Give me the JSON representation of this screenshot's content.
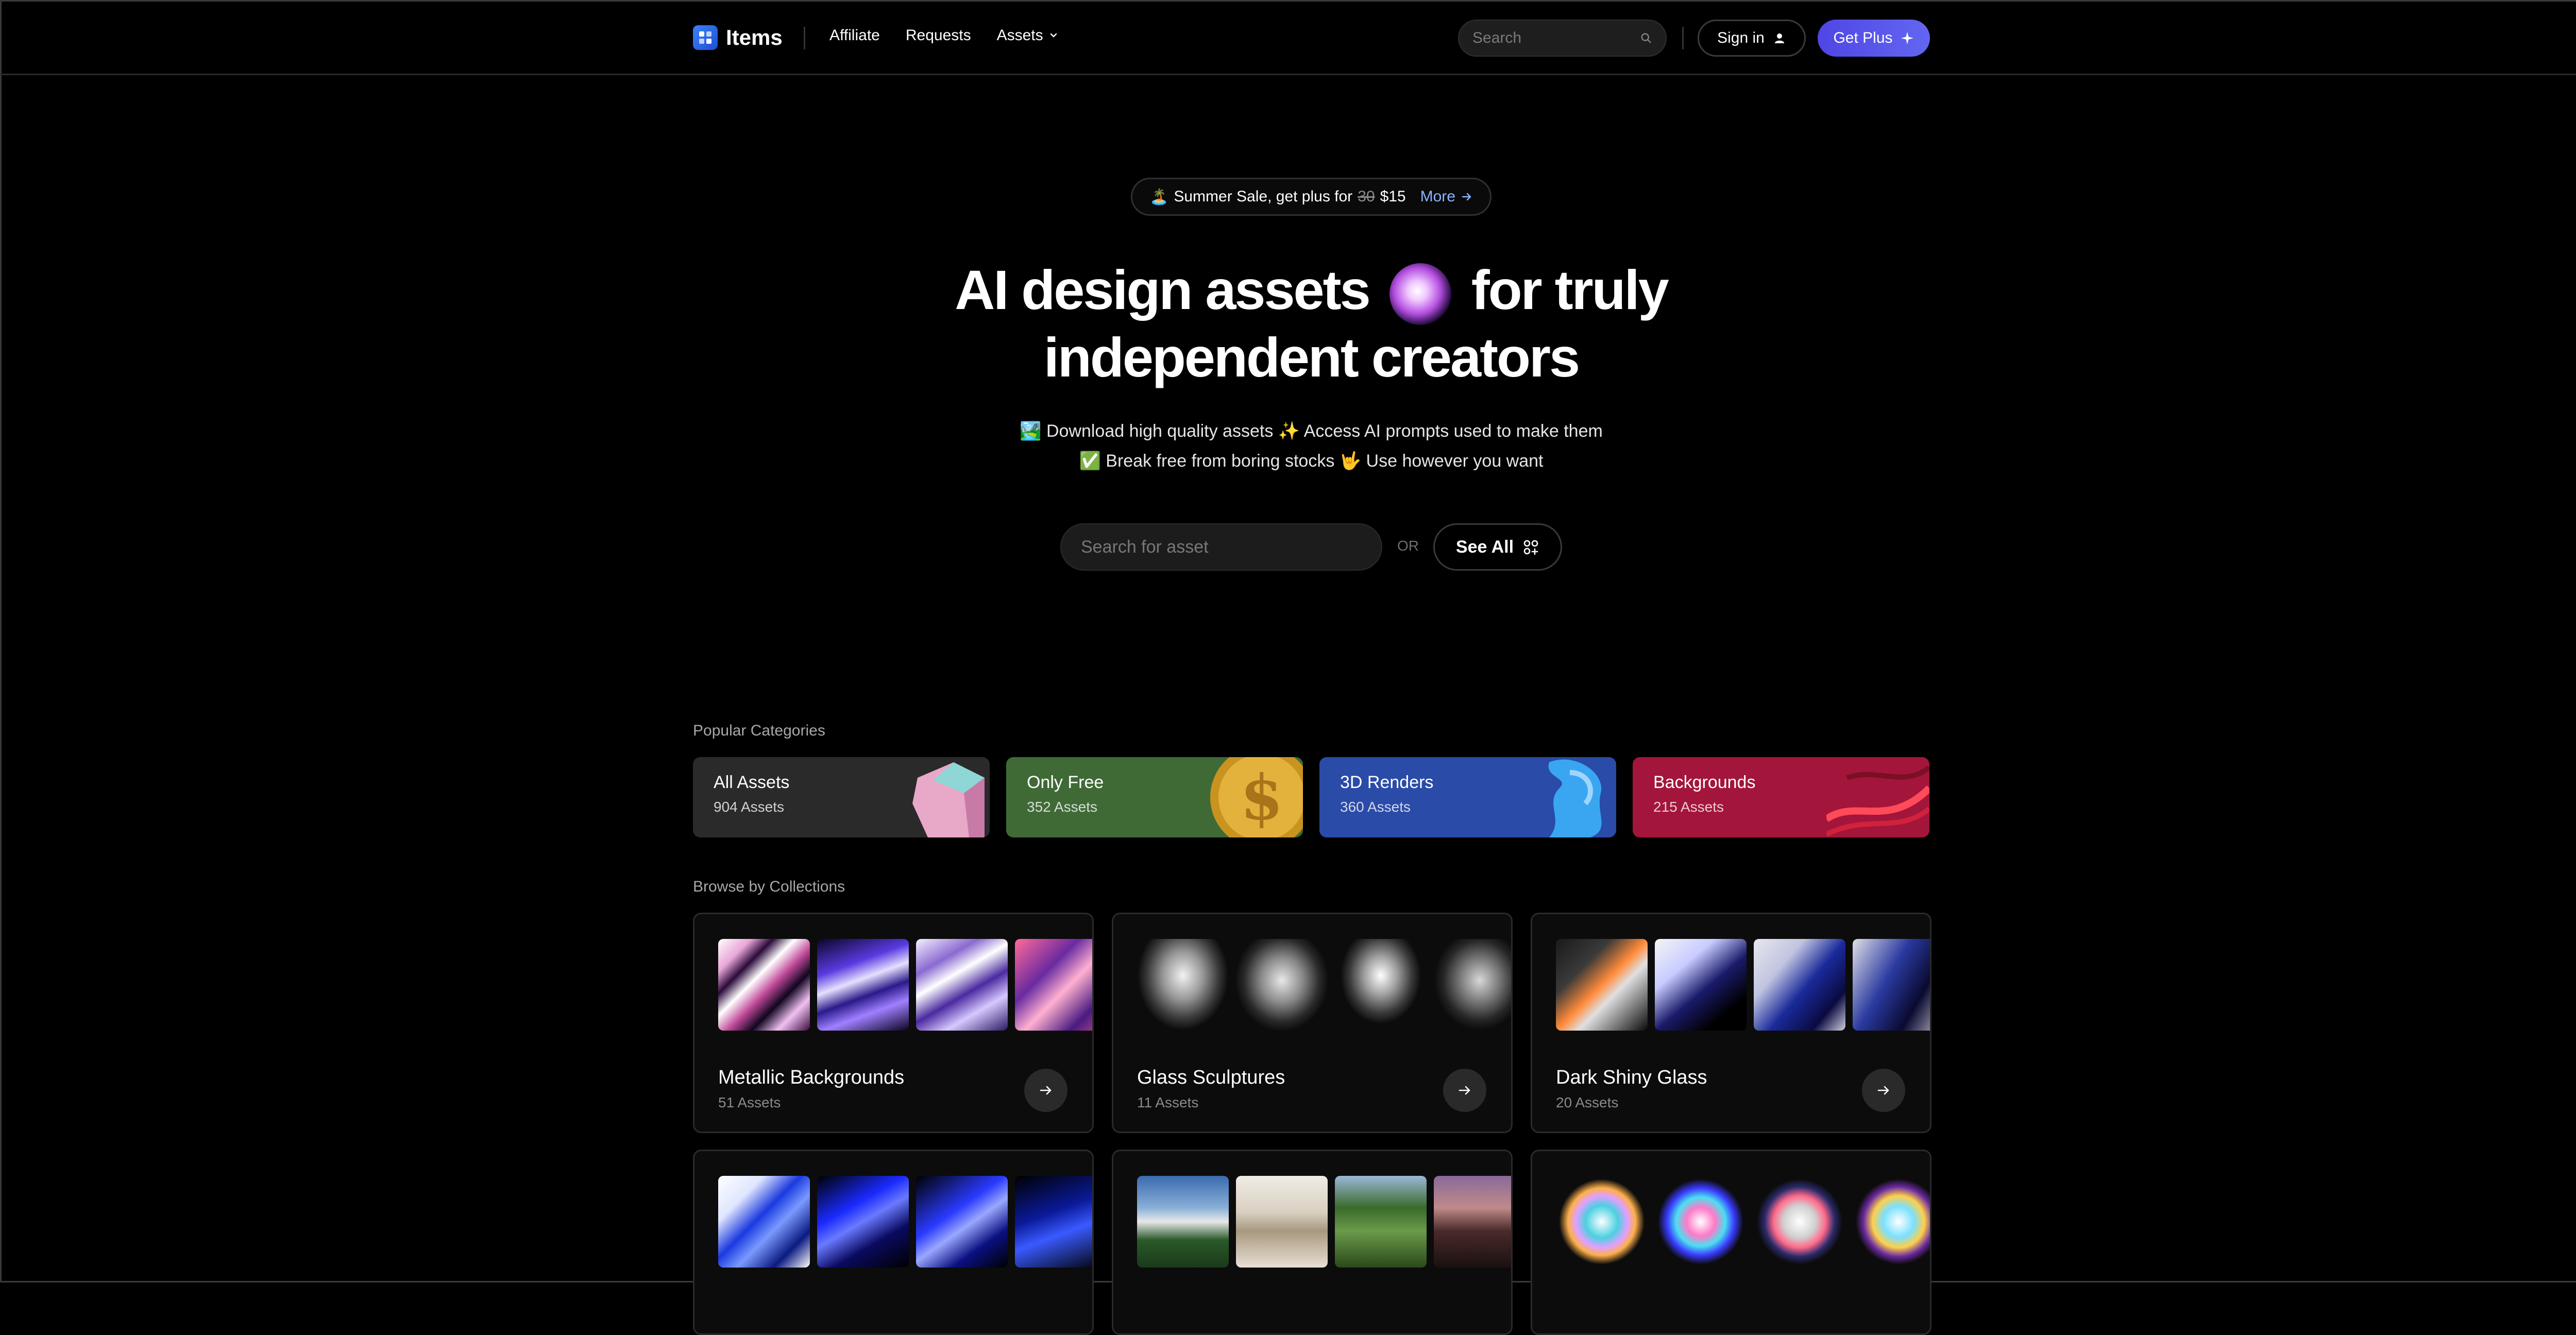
{
  "header": {
    "brand": "Items",
    "nav": [
      "Affiliate",
      "Requests",
      "Assets"
    ],
    "search_placeholder": "Search",
    "sign_in": "Sign in",
    "get_plus": "Get Plus"
  },
  "promo": {
    "text": "Summer Sale, get plus for",
    "old_price": "30",
    "new_price": "$15",
    "more": "More"
  },
  "hero": {
    "line1a": "AI design assets",
    "line1b": "for truly",
    "line2": "independent creators",
    "sub1": "🏞️ Download high quality assets ✨ Access AI prompts used to make them",
    "sub2": "✅ Break free from boring stocks 🤟 Use however you want",
    "search_placeholder": "Search for asset",
    "or": "OR",
    "see_all": "See All"
  },
  "popular": {
    "label": "Popular Categories",
    "items": [
      {
        "title": "All Assets",
        "count": "904 Assets",
        "color": "#2a2a2a"
      },
      {
        "title": "Only Free",
        "count": "352 Assets",
        "color": "#3f6a36"
      },
      {
        "title": "3D Renders",
        "count": "360 Assets",
        "color": "#2a4ba8"
      },
      {
        "title": "Backgrounds",
        "count": "215 Assets",
        "color": "#a3153a"
      }
    ]
  },
  "collections": {
    "label": "Browse by Collections",
    "items": [
      {
        "name": "Metallic Backgrounds",
        "count": "51 Assets"
      },
      {
        "name": "Glass Sculptures",
        "count": "11 Assets"
      },
      {
        "name": "Dark Shiny Glass",
        "count": "20 Assets"
      },
      {
        "name": "",
        "count": ""
      },
      {
        "name": "",
        "count": ""
      },
      {
        "name": "",
        "count": ""
      }
    ]
  }
}
